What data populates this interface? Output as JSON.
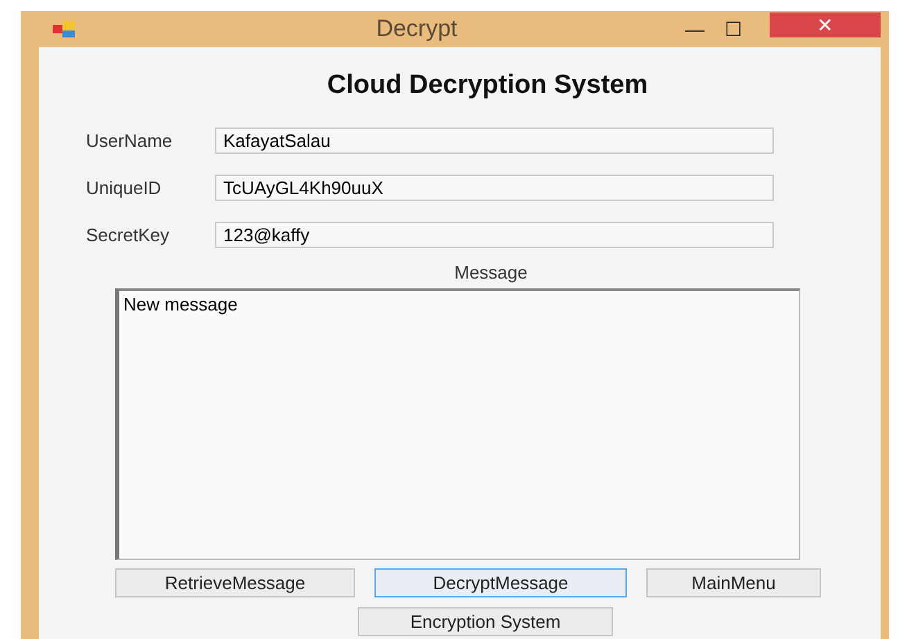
{
  "window": {
    "title": "Decrypt",
    "controls": [
      "—",
      "☐",
      "✕"
    ]
  },
  "heading": "Cloud Decryption System",
  "fields": [
    {
      "label": "UserName",
      "value": "KafayatSalau"
    },
    {
      "label": "UniqueID",
      "value": "TcUAyGL4Kh90uuX"
    },
    {
      "label": "SecretKey",
      "value": "123@kaffy"
    }
  ],
  "message": {
    "label": "Message",
    "value": "New message"
  },
  "buttons": [
    {
      "label": "RetrieveMessage",
      "focused": false
    },
    {
      "label": "DecryptMessage",
      "focused": true
    },
    {
      "label": "MainMenu",
      "focused": false
    }
  ],
  "bottom_button": {
    "label": "Encryption System",
    "focused": false
  }
}
